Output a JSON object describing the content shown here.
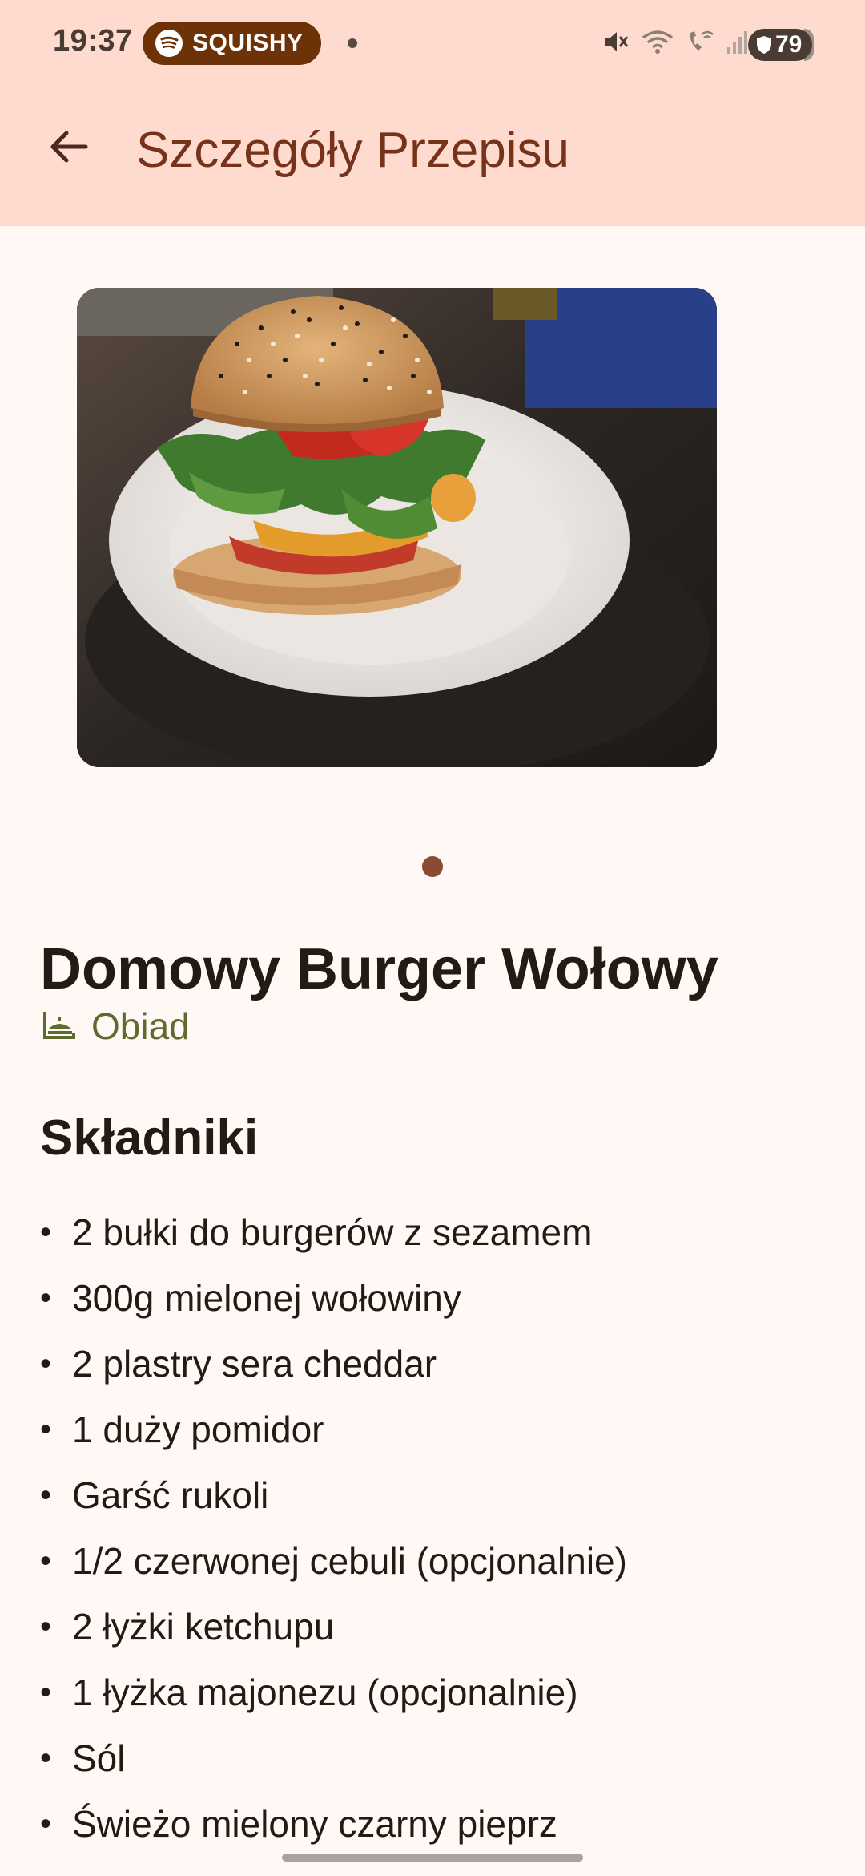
{
  "status_bar": {
    "time": "19:37",
    "media_app": "SQUISHY",
    "battery": "79"
  },
  "app_bar": {
    "title": "Szczegóły Przepisu",
    "back_icon": "arrow-left-icon"
  },
  "gallery": {
    "image_subject": "burger-photo",
    "pages": 1,
    "current_page": 1
  },
  "recipe": {
    "title": "Domowy Burger Wołowy",
    "category": "Obiad",
    "category_icon": "dinner-icon"
  },
  "ingredients_section": {
    "title": "Składniki",
    "items": [
      "2 bułki do burgerów z sezamem",
      "300g mielonej wołowiny",
      "2 plastry sera cheddar",
      "1 duży pomidor",
      "Garść rukoli",
      "1/2 czerwonej cebuli (opcjonalnie)",
      "2 łyżki ketchupu",
      "1 łyżka majonezu (opcjonalnie)",
      "Sól",
      "Świeżo mielony czarny pieprz"
    ]
  },
  "colors": {
    "header_bg": "#ffdbcf",
    "page_bg": "#fff8f5",
    "title_color": "#77331a",
    "category_color": "#5e6b2e",
    "pager_active": "#8b4a32"
  }
}
